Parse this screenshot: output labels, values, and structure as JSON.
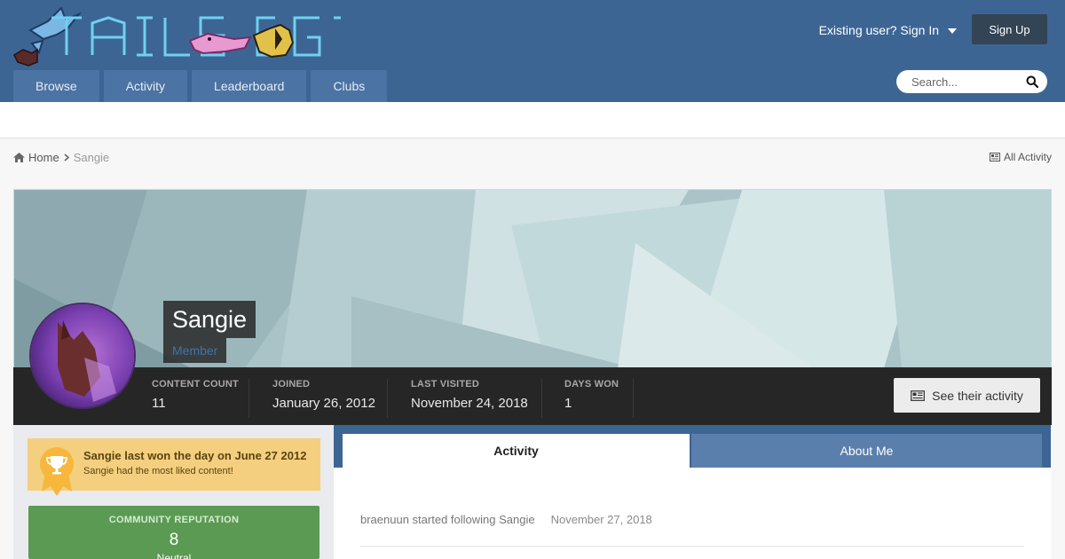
{
  "site": {
    "logo_text": "TAILS REFUGE"
  },
  "header": {
    "signin_label": "Existing user? Sign In",
    "signup_label": "Sign Up",
    "search_placeholder": "Search..."
  },
  "nav": {
    "tabs": [
      {
        "label": "Browse"
      },
      {
        "label": "Activity"
      },
      {
        "label": "Leaderboard"
      },
      {
        "label": "Clubs"
      }
    ]
  },
  "breadcrumb": {
    "home": "Home",
    "current": "Sangie",
    "all_activity": "All Activity"
  },
  "profile": {
    "name": "Sangie",
    "role": "Member",
    "stats": [
      {
        "label": "CONTENT COUNT",
        "value": "11"
      },
      {
        "label": "JOINED",
        "value": "January 26, 2012"
      },
      {
        "label": "LAST VISITED",
        "value": "November 24, 2018"
      },
      {
        "label": "DAYS WON",
        "value": "1"
      }
    ],
    "see_activity_label": "See their activity"
  },
  "days_won": {
    "title": "Sangie last won the day on June 27 2012",
    "subtitle": "Sangie had the most liked content!"
  },
  "reputation": {
    "label": "COMMUNITY REPUTATION",
    "value": "8",
    "status": "Neutral"
  },
  "tabs": {
    "activity": "Activity",
    "about": "About Me"
  },
  "feed": [
    {
      "text": "braenuun started following Sangie",
      "date": "November 27, 2018"
    }
  ],
  "colors": {
    "header_bg": "#3d6594",
    "nav_tab": "#4b73a3",
    "signup_bg": "#334455",
    "stats_bg": "#262626",
    "days_won_bg": "#f4cf7f",
    "reputation_bg": "#5b9a53",
    "role_color": "#3c74a8"
  }
}
